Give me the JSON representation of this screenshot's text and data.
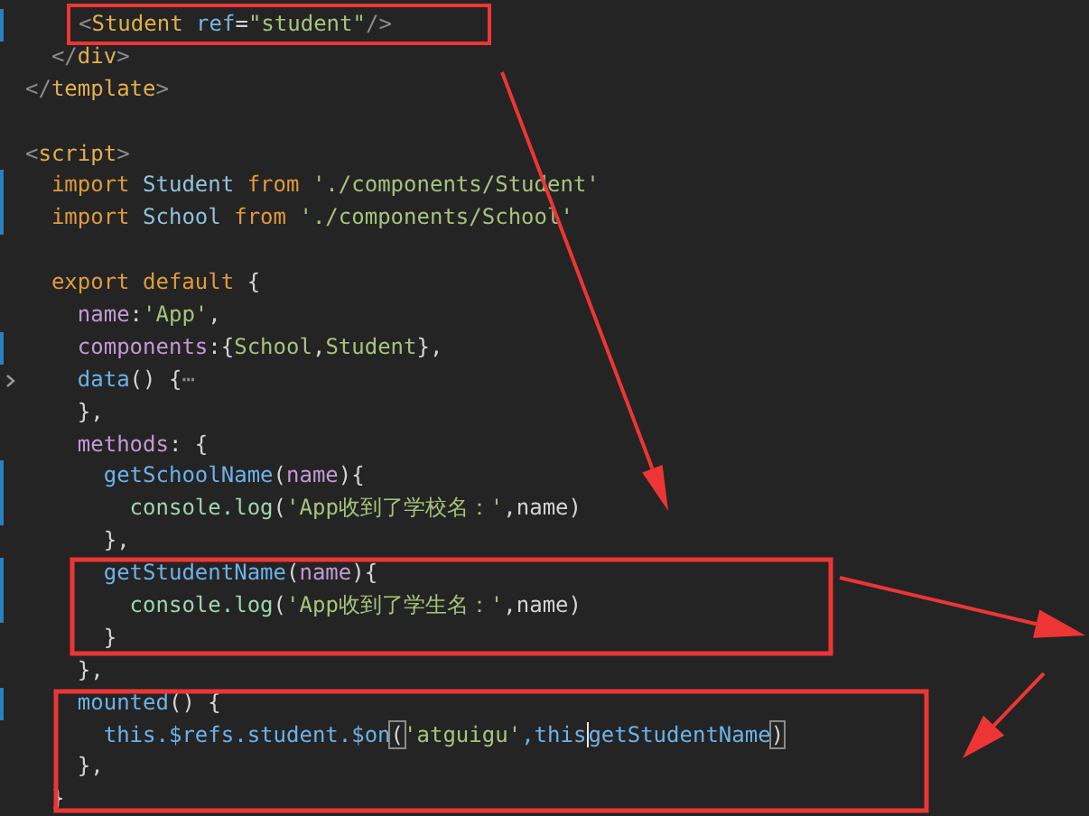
{
  "editor": {
    "blocks": [
      {
        "lines": [
          {
            "modified": true,
            "boxed": true,
            "tokens": [
              {
                "text": "    <",
                "kind": "punct"
              },
              {
                "text": "Student",
                "kind": "tag"
              },
              {
                "text": " ref",
                "kind": "attr"
              },
              {
                "text": "=",
                "kind": "plain"
              },
              {
                "text": "\"student\"",
                "kind": "string"
              },
              {
                "text": "/>",
                "kind": "punct"
              }
            ]
          },
          {
            "modified": false,
            "tokens": [
              {
                "text": "  </",
                "kind": "punct"
              },
              {
                "text": "div",
                "kind": "tag"
              },
              {
                "text": ">",
                "kind": "punct"
              }
            ]
          },
          {
            "modified": false,
            "tokens": [
              {
                "text": "</",
                "kind": "punct"
              },
              {
                "text": "template",
                "kind": "tag"
              },
              {
                "text": ">",
                "kind": "punct"
              }
            ]
          }
        ]
      },
      {
        "lines": [
          {
            "modified": false,
            "tokens": [
              {
                "text": "<",
                "kind": "punct"
              },
              {
                "text": "script",
                "kind": "tag"
              },
              {
                "text": ">",
                "kind": "punct"
              }
            ]
          },
          {
            "modified": true,
            "tokens": [
              {
                "text": "  import",
                "kind": "keyword"
              },
              {
                "text": " Student ",
                "kind": "ident"
              },
              {
                "text": "from",
                "kind": "keyword"
              },
              {
                "text": " './components/Student'",
                "kind": "string"
              }
            ]
          },
          {
            "modified": true,
            "tokens": [
              {
                "text": "  import",
                "kind": "keyword"
              },
              {
                "text": " School ",
                "kind": "ident"
              },
              {
                "text": "from",
                "kind": "keyword"
              },
              {
                "text": " './components/School'",
                "kind": "string"
              }
            ]
          }
        ]
      },
      {
        "lines": [
          {
            "modified": false,
            "tokens": [
              {
                "text": "  export default",
                "kind": "keyword"
              },
              {
                "text": " {",
                "kind": "plain"
              }
            ]
          },
          {
            "modified": false,
            "tokens": [
              {
                "text": "    name",
                "kind": "prop"
              },
              {
                "text": ":",
                "kind": "plain"
              },
              {
                "text": "'App'",
                "kind": "string"
              },
              {
                "text": ",",
                "kind": "plain"
              }
            ]
          },
          {
            "modified": true,
            "tokens": [
              {
                "text": "    components",
                "kind": "prop"
              },
              {
                "text": ":{",
                "kind": "plain"
              },
              {
                "text": "School",
                "kind": "string"
              },
              {
                "text": ",",
                "kind": "plain"
              },
              {
                "text": "Student",
                "kind": "string"
              },
              {
                "text": "},",
                "kind": "plain"
              }
            ]
          },
          {
            "modified": false,
            "folded": true,
            "tokens": [
              {
                "text": "    data",
                "kind": "method"
              },
              {
                "text": "() {",
                "kind": "plain"
              },
              {
                "text": "⋯",
                "kind": "fold"
              }
            ]
          },
          {
            "modified": false,
            "tokens": [
              {
                "text": "    },",
                "kind": "plain"
              }
            ]
          },
          {
            "modified": false,
            "tokens": [
              {
                "text": "    methods",
                "kind": "prop"
              },
              {
                "text": ": {",
                "kind": "plain"
              }
            ]
          },
          {
            "modified": true,
            "tokens": [
              {
                "text": "      getSchoolName",
                "kind": "method"
              },
              {
                "text": "(",
                "kind": "plain"
              },
              {
                "text": "name",
                "kind": "prop"
              },
              {
                "text": "){",
                "kind": "plain"
              }
            ]
          },
          {
            "modified": true,
            "tokens": [
              {
                "text": "        console.log",
                "kind": "console"
              },
              {
                "text": "(",
                "kind": "plain"
              },
              {
                "text": "'App收到了学校名：'",
                "kind": "string"
              },
              {
                "text": ",name)",
                "kind": "plain"
              }
            ]
          },
          {
            "modified": false,
            "tokens": [
              {
                "text": "      },",
                "kind": "plain"
              }
            ]
          },
          {
            "modified": true,
            "tokens": [
              {
                "text": "      getStudentName",
                "kind": "method"
              },
              {
                "text": "(",
                "kind": "plain"
              },
              {
                "text": "name",
                "kind": "prop"
              },
              {
                "text": "){",
                "kind": "plain"
              }
            ]
          },
          {
            "modified": true,
            "tokens": [
              {
                "text": "        console.log",
                "kind": "console"
              },
              {
                "text": "(",
                "kind": "plain"
              },
              {
                "text": "'App收到了学生名：'",
                "kind": "string"
              },
              {
                "text": ",name)",
                "kind": "plain"
              }
            ]
          },
          {
            "modified": false,
            "tokens": [
              {
                "text": "      }",
                "kind": "plain"
              }
            ]
          },
          {
            "modified": false,
            "tokens": [
              {
                "text": "    },",
                "kind": "plain"
              }
            ]
          },
          {
            "modified": true,
            "tokens": [
              {
                "text": "    mounted",
                "kind": "method"
              },
              {
                "text": "() {",
                "kind": "plain"
              }
            ]
          },
          {
            "modified": false,
            "tokens": [
              {
                "text": "      this.$refs.student.$on",
                "kind": "method"
              },
              {
                "text": "(",
                "kind": "bracket"
              },
              {
                "text": "'atguigu'",
                "kind": "string"
              },
              {
                "text": ",this",
                "kind": "method"
              },
              {
                "kind": "cursor"
              },
              {
                "text": "getStudentName",
                "kind": "method"
              },
              {
                "text": ")",
                "kind": "bracket"
              }
            ]
          },
          {
            "modified": false,
            "tokens": [
              {
                "text": "    },",
                "kind": "plain"
              }
            ]
          },
          {
            "modified": false,
            "tokens": [
              {
                "text": "  }",
                "kind": "plain"
              }
            ]
          }
        ]
      }
    ]
  }
}
